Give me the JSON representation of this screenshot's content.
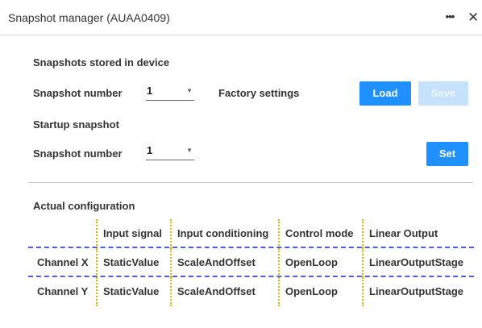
{
  "window": {
    "title": "Snapshot manager (AUAA0409)",
    "more_label": "•••",
    "close_label": "✕"
  },
  "stored": {
    "heading": "Snapshots stored in device",
    "snapshot_label": "Snapshot number",
    "snapshot_value": "1",
    "factory_label": "Factory settings",
    "load_label": "Load",
    "save_label": "Save"
  },
  "startup": {
    "heading": "Startup snapshot",
    "snapshot_label": "Snapshot number",
    "snapshot_value": "1",
    "set_label": "Set"
  },
  "config": {
    "heading": "Actual configuration",
    "columns": [
      "",
      "Input signal",
      "Input conditioning",
      "Control mode",
      "Linear Output"
    ],
    "rows": [
      [
        "Channel X",
        "StaticValue",
        "ScaleAndOffset",
        "OpenLoop",
        "LinearOutputStage"
      ],
      [
        "Channel Y",
        "StaticValue",
        "ScaleAndOffset",
        "OpenLoop",
        "LinearOutputStage"
      ]
    ]
  },
  "colors": {
    "primary": "#1e90ff",
    "disabled": "#c6e1fb",
    "row_separator": "#4a5fd4",
    "column_separator": "#e6b800"
  }
}
